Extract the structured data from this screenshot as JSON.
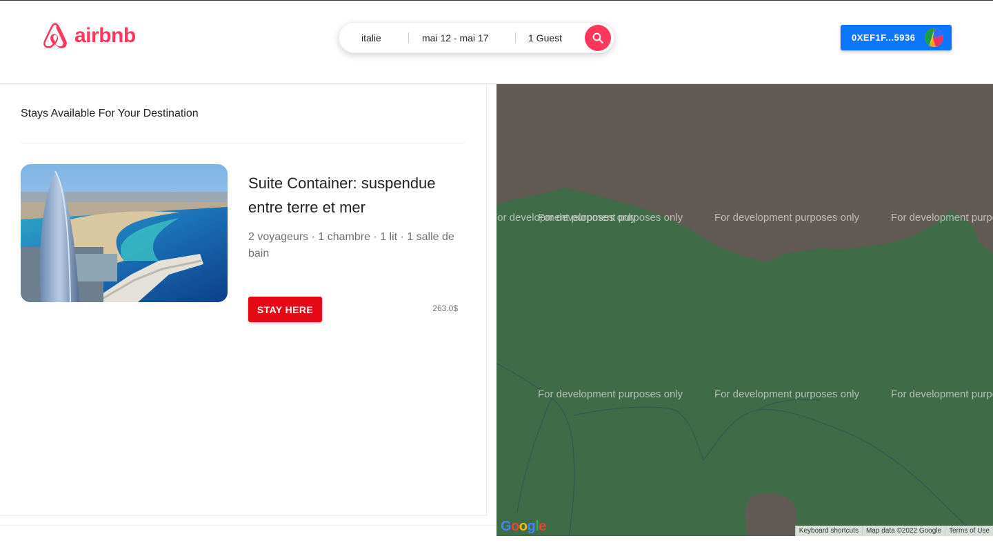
{
  "header": {
    "brand": "airbnb",
    "search": {
      "location": "italie",
      "dates": "mai 12 - mai 17",
      "guests": "1 Guest"
    },
    "wallet_label": "0XEF1F...5936"
  },
  "list": {
    "heading": "Stays Available For Your Destination",
    "items": [
      {
        "title": "Suite Container: suspendue entre terre et mer",
        "description": "2 voyageurs · 1 chambre · 1 lit · 1 salle de bain",
        "button_label": "STAY HERE",
        "price": "263.0$"
      }
    ]
  },
  "map": {
    "watermark": "For development purposes only",
    "footer": {
      "shortcuts": "Keyboard shortcuts",
      "data": "Map data ©2022 Google",
      "terms": "Terms of Use"
    }
  },
  "colors": {
    "brand": "#FF385C",
    "wallet": "#0E76FD",
    "stay_button": "#E50914",
    "map_land": "#3f6b47",
    "map_rock": "#625b55"
  },
  "icons": [
    "airbnb-logo-icon",
    "search-icon",
    "wallet-avatar-icon",
    "google-logo"
  ]
}
